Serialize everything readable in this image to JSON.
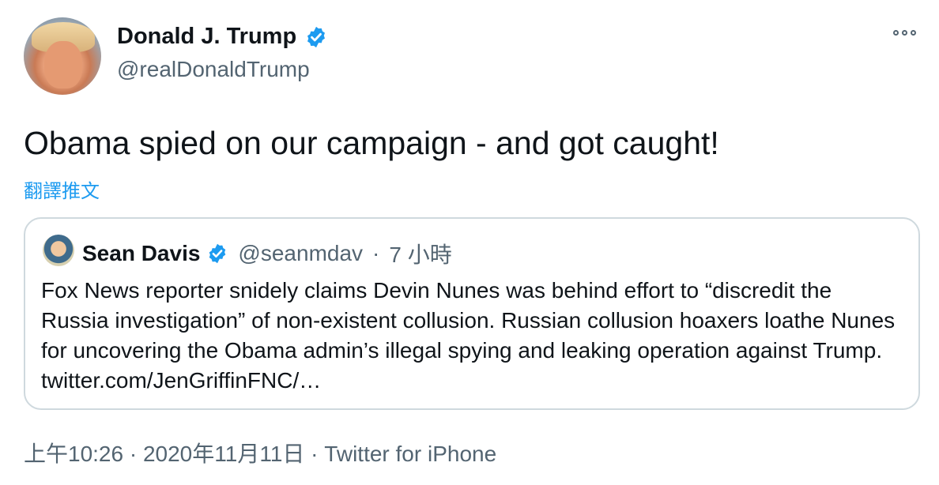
{
  "tweet": {
    "author_name": "Donald J. Trump",
    "author_handle": "@realDonaldTrump",
    "text": "Obama spied on our campaign - and got caught!",
    "translate_label": "翻譯推文"
  },
  "quoted_tweet": {
    "author_name": "Sean Davis",
    "author_handle": "@seanmdav",
    "separator": "·",
    "time_ago": "7 小時",
    "text": "Fox News reporter snidely claims Devin Nunes was behind effort to “discredit the Russia investigation” of non-existent collusion. Russian collusion hoaxers loathe Nunes for uncovering the Obama admin’s illegal spying and leaking operation against Trump. twitter.com/JenGriffinFNC/…"
  },
  "footer": {
    "time": "上午10:26",
    "sep1": " · ",
    "date": "2020年11月11日",
    "sep2": " · ",
    "source": "Twitter for iPhone"
  },
  "icons": {
    "verified": "verified-badge-icon",
    "more": "more-options-icon"
  },
  "colors": {
    "accent": "#1d9bf0",
    "secondary_text": "#536471",
    "border": "#cfd9de"
  }
}
